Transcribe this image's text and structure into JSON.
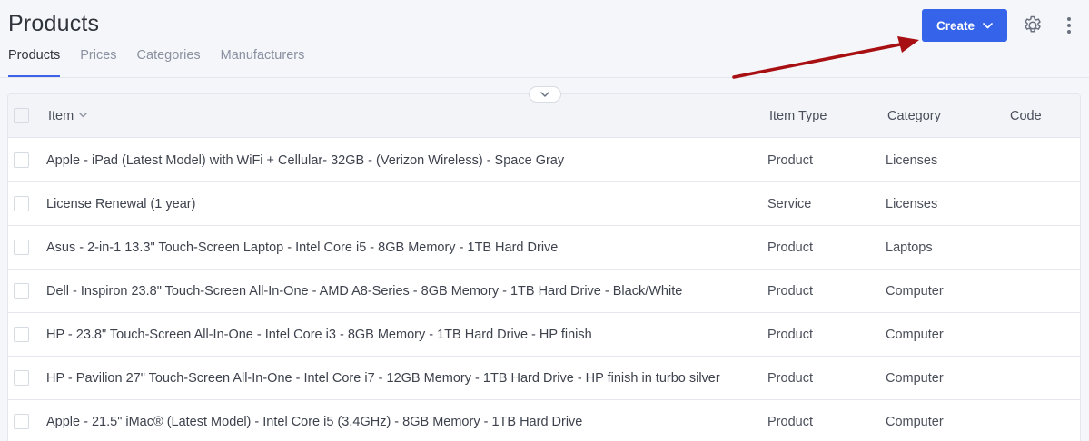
{
  "page": {
    "title": "Products",
    "tabs": [
      {
        "label": "Products",
        "active": true
      },
      {
        "label": "Prices",
        "active": false
      },
      {
        "label": "Categories",
        "active": false
      },
      {
        "label": "Manufacturers",
        "active": false
      }
    ]
  },
  "toolbar": {
    "create_label": "Create",
    "create_icon": "chevron-down-icon",
    "settings_icon": "gear-icon",
    "more_icon": "kebab-menu-icon"
  },
  "colors": {
    "accent": "#3563e9",
    "annotation_arrow": "#a80f12"
  },
  "table": {
    "headers": {
      "item": "Item",
      "item_type": "Item Type",
      "category": "Category",
      "code": "Code"
    },
    "rows": [
      {
        "item": "Apple - iPad (Latest Model) with WiFi + Cellular- 32GB - (Verizon Wireless) - Space Gray",
        "item_type": "Product",
        "category": "Licenses",
        "code": ""
      },
      {
        "item": "License Renewal (1 year)",
        "item_type": "Service",
        "category": "Licenses",
        "code": ""
      },
      {
        "item": "Asus - 2-in-1 13.3\" Touch-Screen Laptop - Intel Core i5 - 8GB Memory - 1TB Hard Drive",
        "item_type": "Product",
        "category": "Laptops",
        "code": ""
      },
      {
        "item": "Dell - Inspiron 23.8\" Touch-Screen All-In-One - AMD A8-Series - 8GB Memory - 1TB Hard Drive - Black/White",
        "item_type": "Product",
        "category": "Computer",
        "code": ""
      },
      {
        "item": "HP - 23.8\" Touch-Screen All-In-One - Intel Core i3 - 8GB Memory - 1TB Hard Drive - HP finish",
        "item_type": "Product",
        "category": "Computer",
        "code": ""
      },
      {
        "item": "HP - Pavilion 27\" Touch-Screen All-In-One - Intel Core i7 - 12GB Memory - 1TB Hard Drive - HP finish in turbo silver",
        "item_type": "Product",
        "category": "Computer",
        "code": ""
      },
      {
        "item": "Apple - 21.5\" iMac® (Latest Model) - Intel Core i5 (3.4GHz) - 8GB Memory - 1TB Hard Drive",
        "item_type": "Product",
        "category": "Computer",
        "code": ""
      }
    ]
  }
}
